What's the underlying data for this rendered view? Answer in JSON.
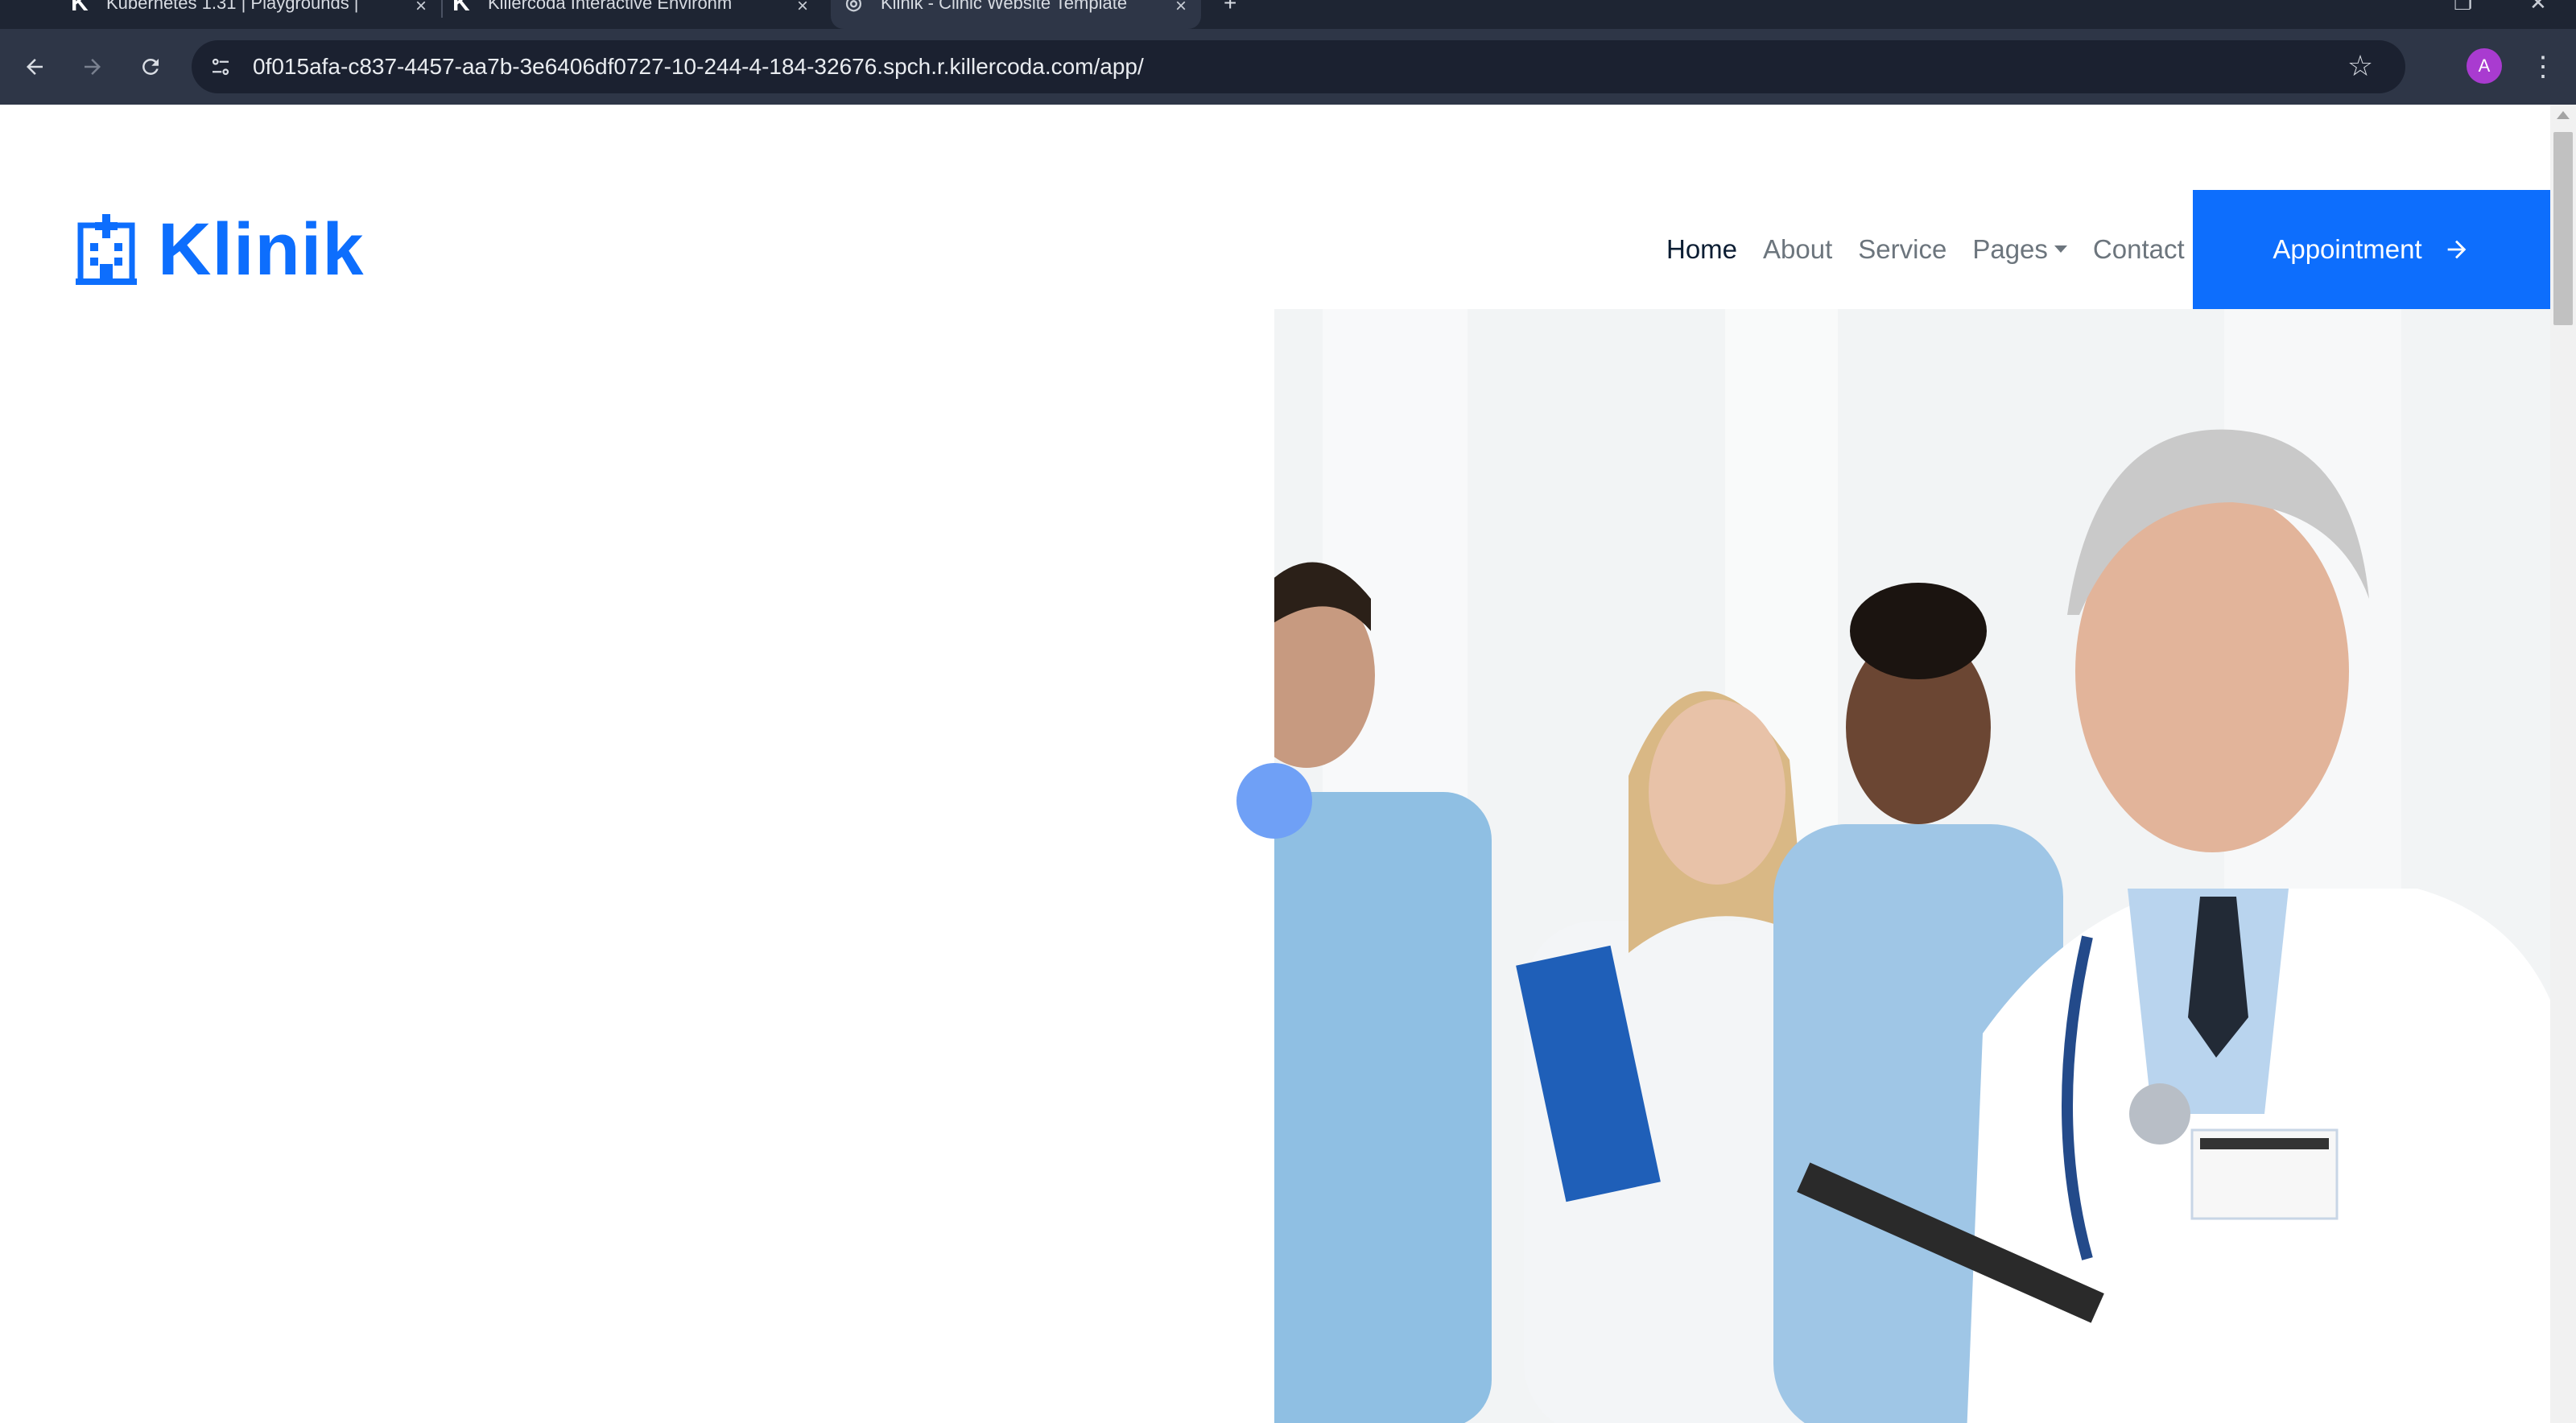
{
  "browser": {
    "tabs": [
      {
        "title": "Kubernetes 1.31 | Playgrounds |",
        "active": false
      },
      {
        "title": "Killercoda Interactive Environm",
        "active": false
      },
      {
        "title": "Klinik - Clinic Website Template",
        "active": true
      }
    ],
    "new_tab_label": "+",
    "url": "0f015afa-c837-4457-aa7b-3e6406df0727-10-244-4-184-32676.spch.r.killercoda.com/app/",
    "profile_initial": "A"
  },
  "site": {
    "brand": "Klinik",
    "nav": [
      {
        "label": "Home",
        "active": true
      },
      {
        "label": "About",
        "active": false
      },
      {
        "label": "Service",
        "active": false
      },
      {
        "label": "Pages",
        "active": false,
        "dropdown": true
      },
      {
        "label": "Contact",
        "active": false
      }
    ],
    "cta_label": "Appointment",
    "accent_color": "#0d6efd"
  }
}
